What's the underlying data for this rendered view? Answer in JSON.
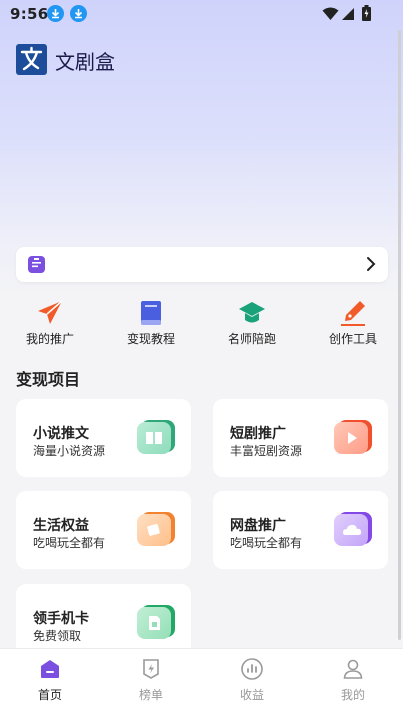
{
  "status": {
    "time": "9:56"
  },
  "app": {
    "title": "文剧盒"
  },
  "notice": {
    "text": ""
  },
  "quick_actions": [
    {
      "label": "我的推广",
      "icon": "paper-plane-icon",
      "color": "#f15a29"
    },
    {
      "label": "变现教程",
      "icon": "book-icon",
      "color": "#4a5ee0"
    },
    {
      "label": "名师陪跑",
      "icon": "graduation-cap-icon",
      "color": "#1aa37a"
    },
    {
      "label": "创作工具",
      "icon": "pen-icon",
      "color": "#f15a29"
    }
  ],
  "section": {
    "title": "变现项目"
  },
  "projects": [
    {
      "title": "小说推文",
      "subtitle": "海量小说资源",
      "icon": "book-open-icon",
      "color": "#3db88a"
    },
    {
      "title": "短剧推广",
      "subtitle": "丰富短剧资源",
      "icon": "play-icon",
      "color": "#f55a3c"
    },
    {
      "title": "生活权益",
      "subtitle": "吃喝玩全都有",
      "icon": "gift-icon",
      "color": "#f28a3a"
    },
    {
      "title": "网盘推广",
      "subtitle": "吃喝玩全都有",
      "icon": "cloud-icon",
      "color": "#8a55e8"
    },
    {
      "title": "领手机卡",
      "subtitle": "免费领取",
      "icon": "sim-card-icon",
      "color": "#2fae6f"
    }
  ],
  "nav": [
    {
      "label": "首页",
      "icon": "home-icon",
      "active": true
    },
    {
      "label": "榜单",
      "icon": "ranking-icon",
      "active": false
    },
    {
      "label": "收益",
      "icon": "earnings-icon",
      "active": false
    },
    {
      "label": "我的",
      "icon": "profile-icon",
      "active": false
    }
  ],
  "colors": {
    "accent": "#7b4fe0",
    "hero_top": "#cfd3fb"
  }
}
